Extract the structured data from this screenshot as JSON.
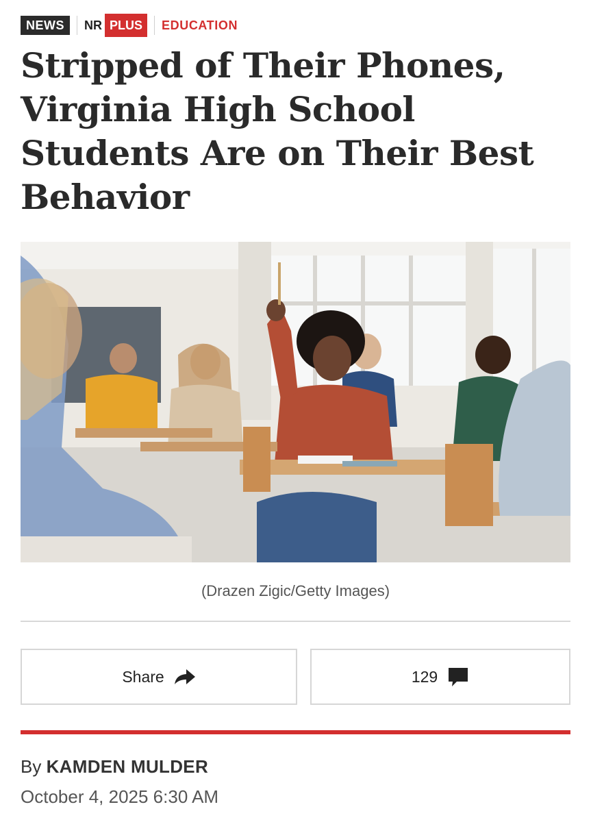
{
  "tags": {
    "news": "NEWS",
    "nr": "NR",
    "plus": "PLUS",
    "section": "EDUCATION"
  },
  "headline": "Stripped of Their Phones, Virginia High School Students Are on Their Best Behavior",
  "image": {
    "caption": "(Drazen Zigic/Getty Images)"
  },
  "actions": {
    "share_label": "Share",
    "comment_count": "129"
  },
  "byline": {
    "prefix": "By",
    "author": "KAMDEN MULDER",
    "date": "October 4, 2025 6:30 AM"
  },
  "colors": {
    "accent": "#d32f2f",
    "tag_dark": "#2b2b2b"
  }
}
